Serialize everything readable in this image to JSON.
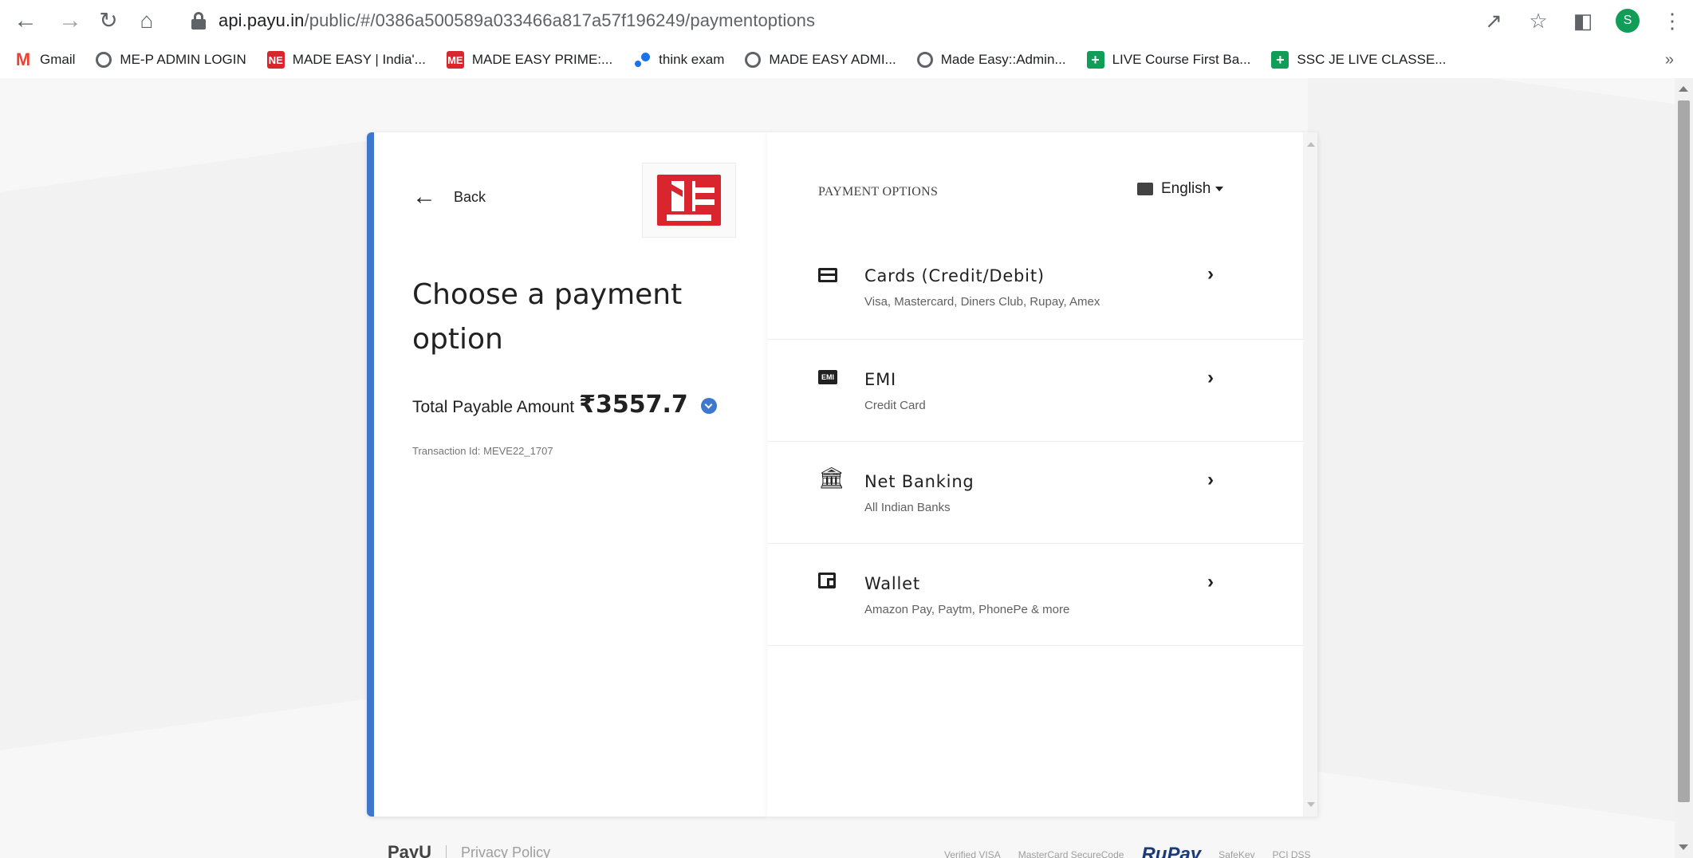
{
  "browser": {
    "url_host": "api.payu.in",
    "url_path": "/public/#/0386a500589a033466a817a57f196249/paymentoptions",
    "avatar_letter": "S"
  },
  "bookmarks": [
    {
      "label": "Gmail",
      "icon": "gmail-icon"
    },
    {
      "label": "ME-P ADMIN LOGIN",
      "icon": "globe-icon"
    },
    {
      "label": "MADE EASY | India'...",
      "icon": "made-easy-icon"
    },
    {
      "label": "MADE EASY PRIME:...",
      "icon": "made-easy-prime-icon"
    },
    {
      "label": "think exam",
      "icon": "think-exam-icon"
    },
    {
      "label": "MADE EASY ADMI...",
      "icon": "globe-icon"
    },
    {
      "label": "Made Easy::Admin...",
      "icon": "globe-icon"
    },
    {
      "label": "LIVE Course First Ba...",
      "icon": "sheets-icon"
    },
    {
      "label": "SSC JE LIVE CLASSE...",
      "icon": "sheets-icon"
    }
  ],
  "left": {
    "back_label": "Back",
    "heading": "Choose a payment option",
    "amount_label": "Total Payable Amount",
    "amount_value": "₹3557.7",
    "transaction": "Transaction Id: MEVE22_1707"
  },
  "right": {
    "title": "PAYMENT OPTIONS",
    "language": "English",
    "options": [
      {
        "title": "Cards (Credit/Debit)",
        "subtitle": "Visa, Mastercard, Diners Club, Rupay, Amex",
        "icon": "card-icon"
      },
      {
        "title": "EMI",
        "subtitle": "Credit Card",
        "icon": "emi-icon"
      },
      {
        "title": "Net Banking",
        "subtitle": "All Indian Banks",
        "icon": "bank-icon"
      },
      {
        "title": "Wallet",
        "subtitle": "Amazon Pay, Paytm, PhonePe & more",
        "icon": "wallet-icon"
      }
    ]
  },
  "footer": {
    "brand": "PayU",
    "privacy": "Privacy Policy",
    "badges": [
      "Verified VISA",
      "MasterCard SecureCode",
      "RuPay",
      "SafeKey",
      "PCI DSS"
    ]
  },
  "colors": {
    "accent": "#3d78cc",
    "brand_red": "#d9262e"
  }
}
